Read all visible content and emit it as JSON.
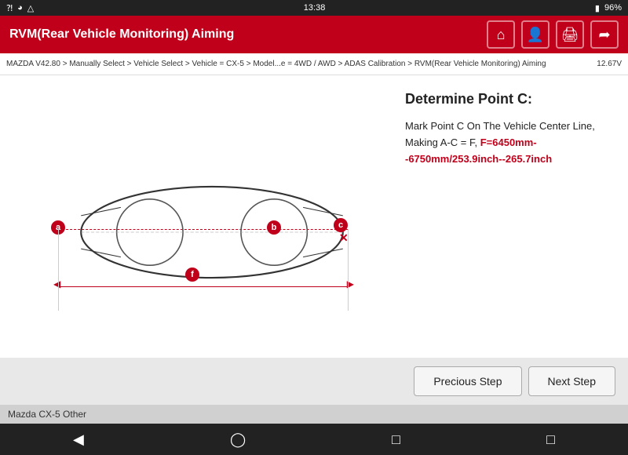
{
  "status_bar": {
    "left": "⬡ △ ⬡",
    "time": "13:38",
    "right": "96%"
  },
  "header": {
    "title": "RVM(Rear Vehicle Monitoring) Aiming",
    "icons": [
      "home",
      "person",
      "print",
      "logout"
    ]
  },
  "breadcrumb": "MAZDA V42.80 > Manually Select > Vehicle Select > Vehicle = CX-5 > Model...e = 4WD / AWD > ADAS Calibration > RVM(Rear Vehicle Monitoring) Aiming",
  "battery_label": "12.67V",
  "info": {
    "title": "Determine Point C:",
    "body_prefix": "Mark Point C On The Vehicle Center Line, Making A-C = F, ",
    "highlight": "F=6450mm--6750mm/253.9inch--265.7inch"
  },
  "points": {
    "a": "a",
    "b": "b",
    "c": "c",
    "f": "f"
  },
  "buttons": {
    "previous": "Precious Step",
    "next": "Next Step"
  },
  "footer": {
    "label": "Mazda CX-5 Other"
  }
}
